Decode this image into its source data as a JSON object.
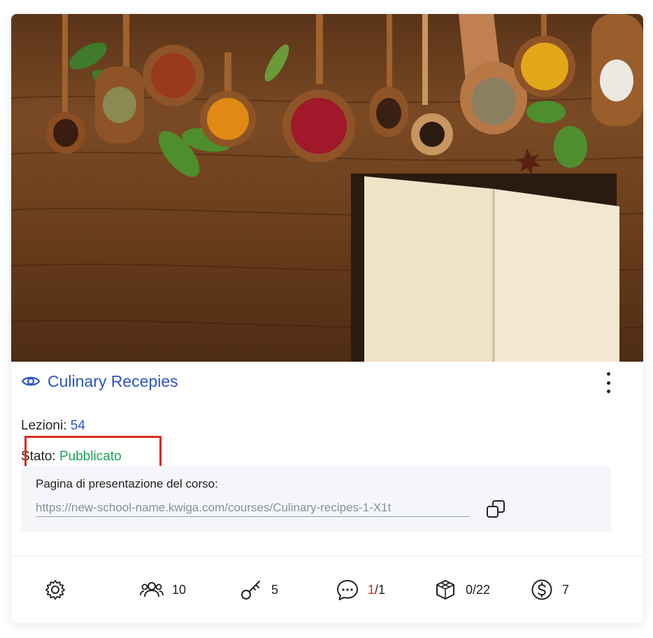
{
  "course": {
    "title": "Culinary Recepies",
    "lessons_label": "Lezioni:",
    "lessons_value": "54",
    "state_label": "Stato:",
    "state_value": "Pubblicato"
  },
  "presentation": {
    "label": "Pagina di presentazione del corso:",
    "url": "https://new-school-name.kwiga.com/courses/Culinary-recipes-1-X1t"
  },
  "stats": {
    "students": "10",
    "keys": "5",
    "comments_unread": "1",
    "comments_total": "/1",
    "modules": "0/22",
    "price": "7"
  },
  "colors": {
    "link": "#2f55c7",
    "published": "#13a45c",
    "highlight": "#e0281f"
  },
  "icons": [
    "eye-icon",
    "more-vertical-icon",
    "copy-icon",
    "settings-icon",
    "users-icon",
    "key-icon",
    "comment-icon",
    "cube-icon",
    "dollar-icon"
  ]
}
